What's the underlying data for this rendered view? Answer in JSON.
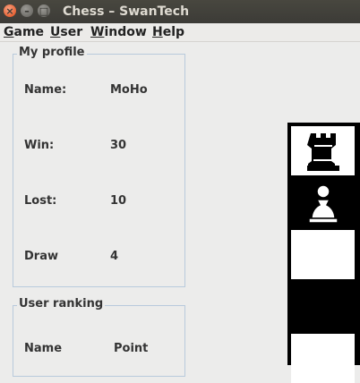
{
  "window": {
    "title": "Chess – SwanTech"
  },
  "menu": {
    "items": [
      {
        "label": "Game",
        "key": "G"
      },
      {
        "label": "User",
        "key": "U"
      },
      {
        "label": "Window",
        "key": "W"
      },
      {
        "label": "Help",
        "key": "H"
      }
    ]
  },
  "profile": {
    "title": "My profile",
    "rows": [
      {
        "label": "Name:",
        "value": "MoHo"
      },
      {
        "label": "Win:",
        "value": "30"
      },
      {
        "label": "Lost:",
        "value": "10"
      },
      {
        "label": "Draw",
        "value": "4"
      }
    ]
  },
  "ranking": {
    "title": "User ranking",
    "headers": {
      "name": "Name",
      "point": "Point"
    }
  },
  "board": {
    "squares": [
      {
        "color": "light",
        "piece": "black-rook",
        "glyph": "♜"
      },
      {
        "color": "dark",
        "piece": "white-pawn",
        "glyph": "♙"
      },
      {
        "color": "light",
        "piece": "",
        "glyph": ""
      },
      {
        "color": "dark",
        "piece": "",
        "glyph": ""
      },
      {
        "color": "light",
        "piece": "",
        "glyph": ""
      }
    ]
  }
}
